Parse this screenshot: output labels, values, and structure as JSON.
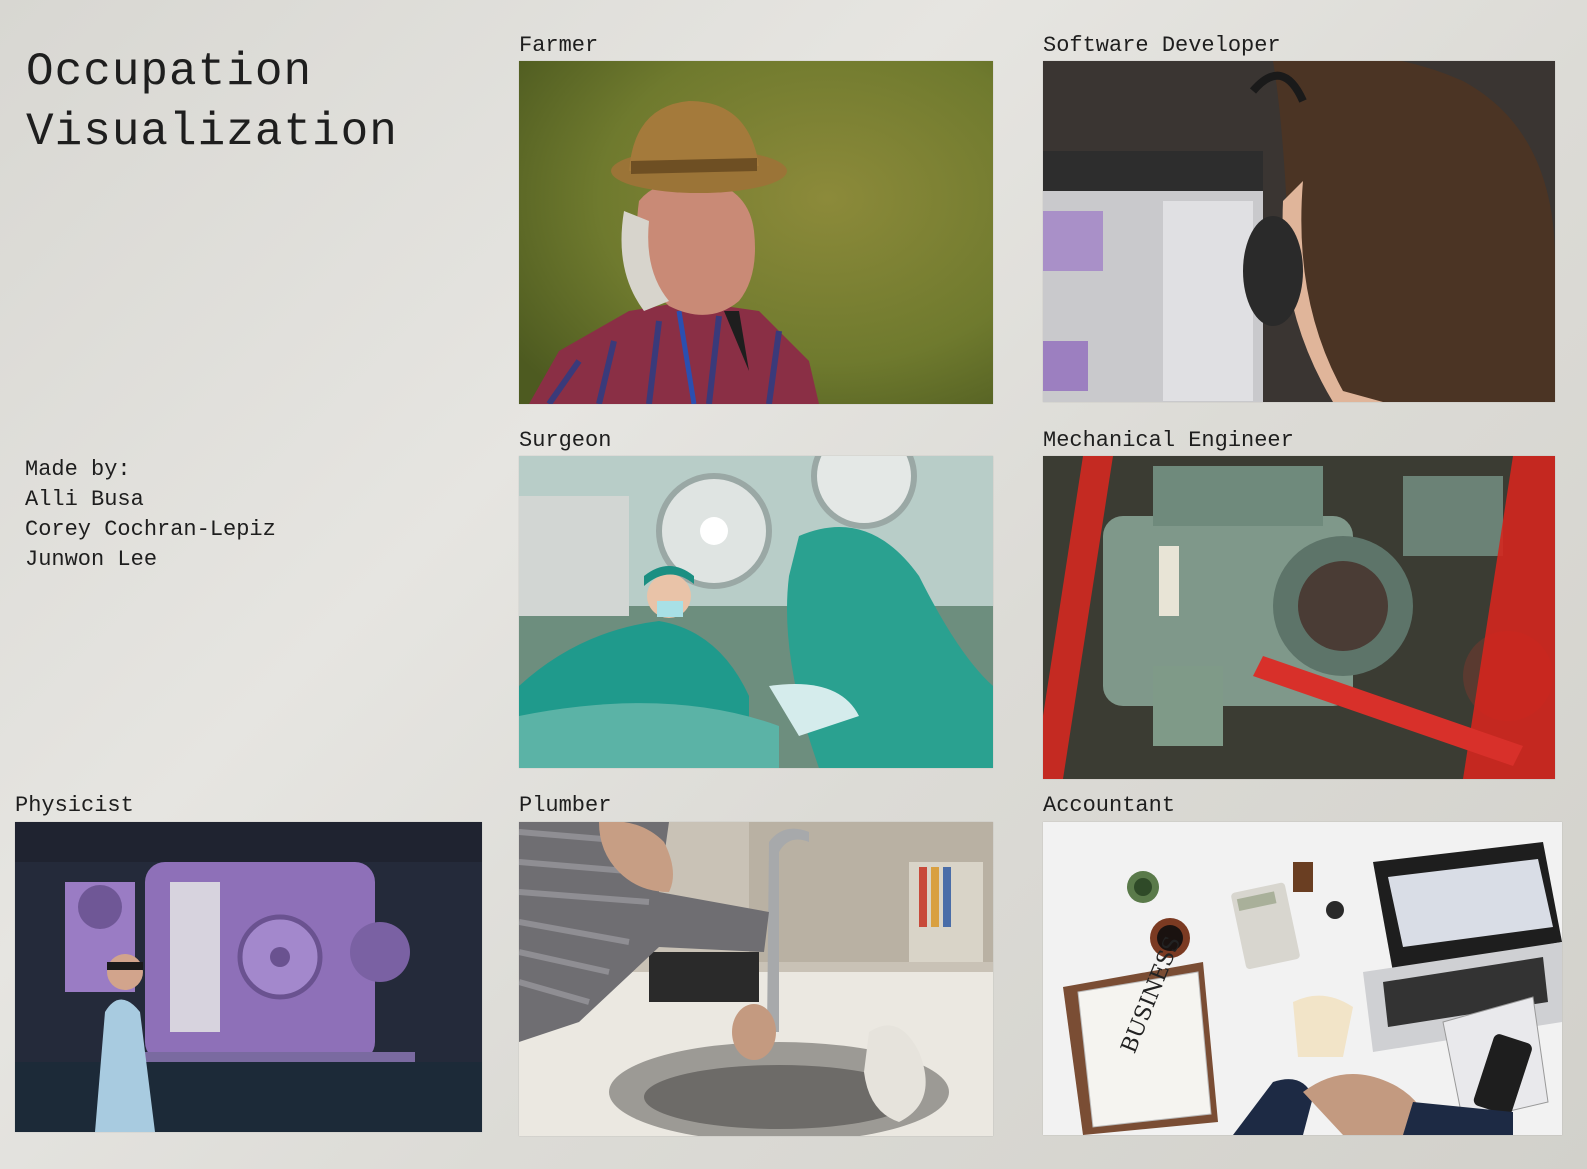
{
  "title": {
    "line1": "Occupation",
    "line2": "Visualization"
  },
  "credits": {
    "heading": "Made by:",
    "authors": [
      "Alli Busa",
      "Corey Cochran-Lepiz",
      "Junwon Lee"
    ]
  },
  "tiles": [
    {
      "label": "Farmer",
      "icon": "farmer-photo"
    },
    {
      "label": "Software Developer",
      "icon": "software-developer-photo"
    },
    {
      "label": "Surgeon",
      "icon": "surgeon-photo"
    },
    {
      "label": "Mechanical Engineer",
      "icon": "mechanical-engineer-photo"
    },
    {
      "label": "Physicist",
      "icon": "physicist-photo"
    },
    {
      "label": "Plumber",
      "icon": "plumber-photo"
    },
    {
      "label": "Accountant",
      "icon": "accountant-photo"
    }
  ],
  "photo_text": {
    "newspaper_masthead": "BUSINESS"
  }
}
